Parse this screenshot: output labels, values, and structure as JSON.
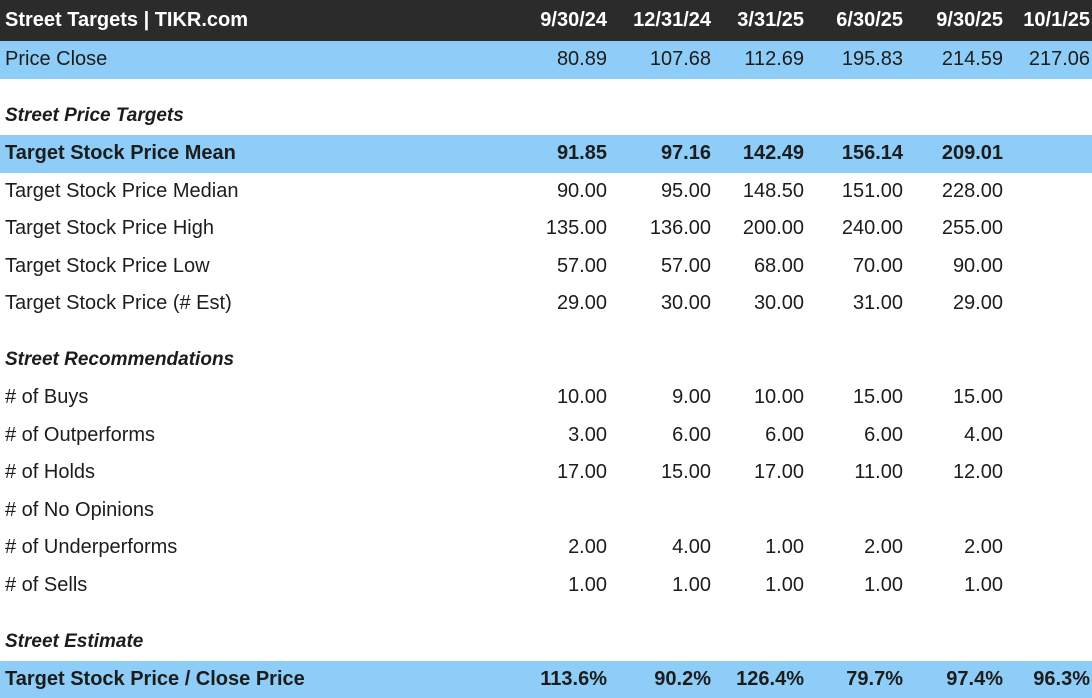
{
  "header": {
    "title": "Street Targets | TIKR.com",
    "columns": [
      "9/30/24",
      "12/31/24",
      "3/31/25",
      "6/30/25",
      "9/30/25",
      "10/1/25"
    ]
  },
  "price_close": {
    "label": "Price Close",
    "values": [
      "80.89",
      "107.68",
      "112.69",
      "195.83",
      "214.59",
      "217.06"
    ]
  },
  "sections": {
    "targets_title": "Street Price Targets",
    "recommendations_title": "Street Recommendations",
    "estimate_title": "Street Estimate"
  },
  "targets": [
    {
      "label": "Target Stock Price Mean",
      "values": [
        "91.85",
        "97.16",
        "142.49",
        "156.14",
        "209.01",
        ""
      ]
    },
    {
      "label": "Target Stock Price Median",
      "values": [
        "90.00",
        "95.00",
        "148.50",
        "151.00",
        "228.00",
        ""
      ]
    },
    {
      "label": "Target Stock Price High",
      "values": [
        "135.00",
        "136.00",
        "200.00",
        "240.00",
        "255.00",
        ""
      ]
    },
    {
      "label": "Target Stock Price Low",
      "values": [
        "57.00",
        "57.00",
        "68.00",
        "70.00",
        "90.00",
        ""
      ]
    },
    {
      "label": "Target Stock Price (# Est)",
      "values": [
        "29.00",
        "30.00",
        "30.00",
        "31.00",
        "29.00",
        ""
      ]
    }
  ],
  "recommendations": [
    {
      "label": "# of Buys",
      "values": [
        "10.00",
        "9.00",
        "10.00",
        "15.00",
        "15.00",
        ""
      ]
    },
    {
      "label": "# of Outperforms",
      "values": [
        "3.00",
        "6.00",
        "6.00",
        "6.00",
        "4.00",
        ""
      ]
    },
    {
      "label": "# of Holds",
      "values": [
        "17.00",
        "15.00",
        "17.00",
        "11.00",
        "12.00",
        ""
      ]
    },
    {
      "label": "# of No Opinions",
      "values": [
        "",
        "",
        "",
        "",
        "",
        ""
      ]
    },
    {
      "label": "# of Underperforms",
      "values": [
        "2.00",
        "4.00",
        "1.00",
        "2.00",
        "2.00",
        ""
      ]
    },
    {
      "label": "# of Sells",
      "values": [
        "1.00",
        "1.00",
        "1.00",
        "1.00",
        "1.00",
        ""
      ]
    }
  ],
  "estimate": {
    "label": "Target Stock Price / Close Price",
    "values": [
      "113.6%",
      "90.2%",
      "126.4%",
      "79.7%",
      "97.4%",
      "96.3%"
    ]
  },
  "colors": {
    "header_bg": "#2b2b2b",
    "header_text": "#ffffff",
    "highlight_bg": "#8ecdf7",
    "body_text": "#1c1c1c"
  }
}
